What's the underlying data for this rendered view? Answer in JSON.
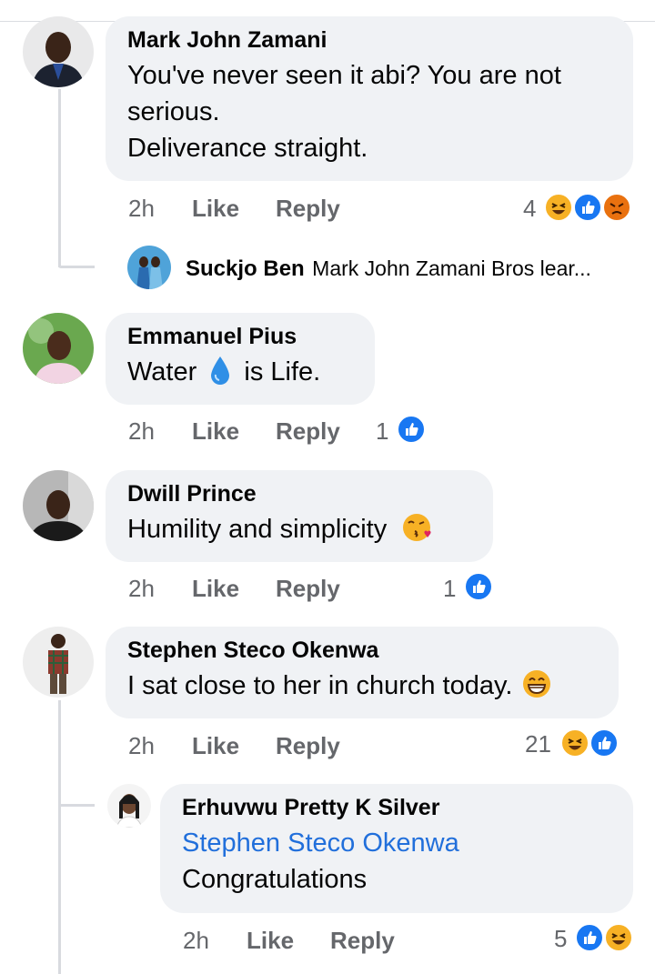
{
  "comments": [
    {
      "name": "Mark John Zamani",
      "lines": [
        "You've never seen it abi? You are not",
        "serious.",
        "Deliverance straight."
      ],
      "time": "2h",
      "like": "Like",
      "reply": "Reply",
      "reaction_count": "4",
      "reactions": [
        "haha-icon",
        "like-icon",
        "angry-icon"
      ]
    },
    {
      "name": "Emmanuel Pius",
      "text_before": "Water",
      "text_after": "is Life.",
      "time": "2h",
      "like": "Like",
      "reply": "Reply",
      "reaction_count": "1",
      "reactions": [
        "like-icon"
      ]
    },
    {
      "name": "Dwill Prince",
      "text": "Humility and simplicity",
      "time": "2h",
      "like": "Like",
      "reply": "Reply",
      "reaction_count": "1",
      "reactions": [
        "like-icon"
      ]
    },
    {
      "name": "Stephen Steco Okenwa",
      "text": "I sat close to her in church today.",
      "time": "2h",
      "like": "Like",
      "reply": "Reply",
      "reaction_count": "21",
      "reactions": [
        "haha-icon",
        "like-icon"
      ]
    }
  ],
  "collapsed_reply": {
    "name": "Suckjo Ben",
    "preview": "Mark John Zamani Bros lear..."
  },
  "reply": {
    "name": "Erhuvwu Pretty K Silver",
    "mention": "Stephen Steco Okenwa",
    "text": "Congratulations",
    "time": "2h",
    "like": "Like",
    "reply": "Reply",
    "reaction_count": "5",
    "reactions": [
      "like-icon",
      "haha-icon"
    ]
  },
  "colors": {
    "bubble": "#f0f2f5",
    "like_blue": "#1877f2",
    "haha_yellow": "#f7b125",
    "angry_orange": "#e9710f",
    "mention_blue": "#216fdb",
    "meta_gray": "#65676b"
  }
}
